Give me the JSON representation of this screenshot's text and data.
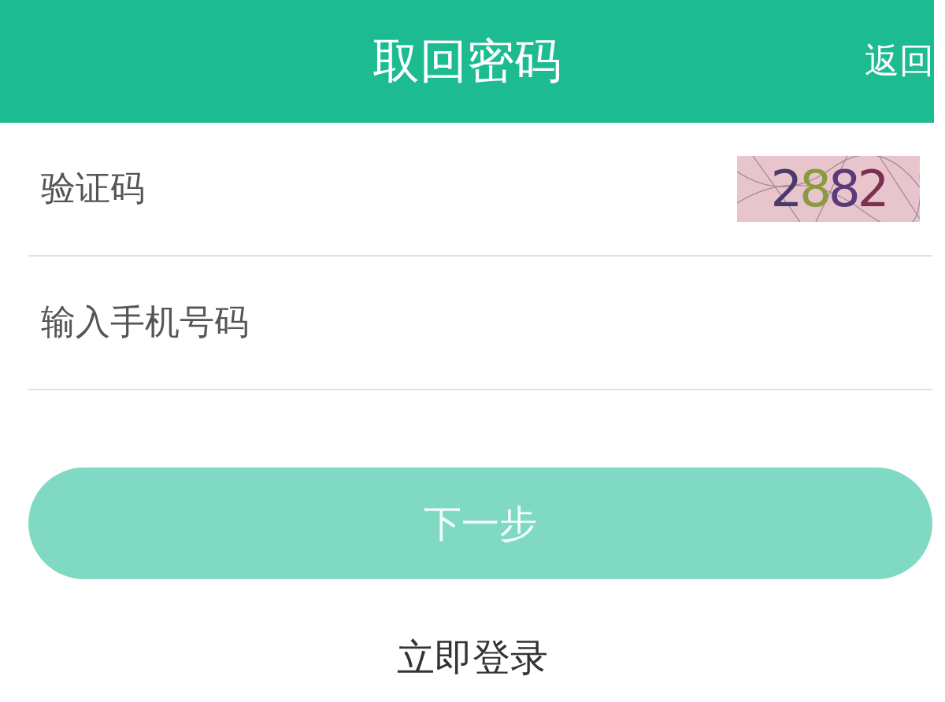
{
  "header": {
    "title": "取回密码",
    "back": "返回"
  },
  "fields": [
    {
      "placeholder": "验证码",
      "kind": "captcha",
      "captcha": "2882"
    },
    {
      "placeholder": "输入手机号码",
      "kind": "text"
    }
  ],
  "next_button": {
    "label": "下一步",
    "disabled": true
  },
  "login_link": "立即登录"
}
